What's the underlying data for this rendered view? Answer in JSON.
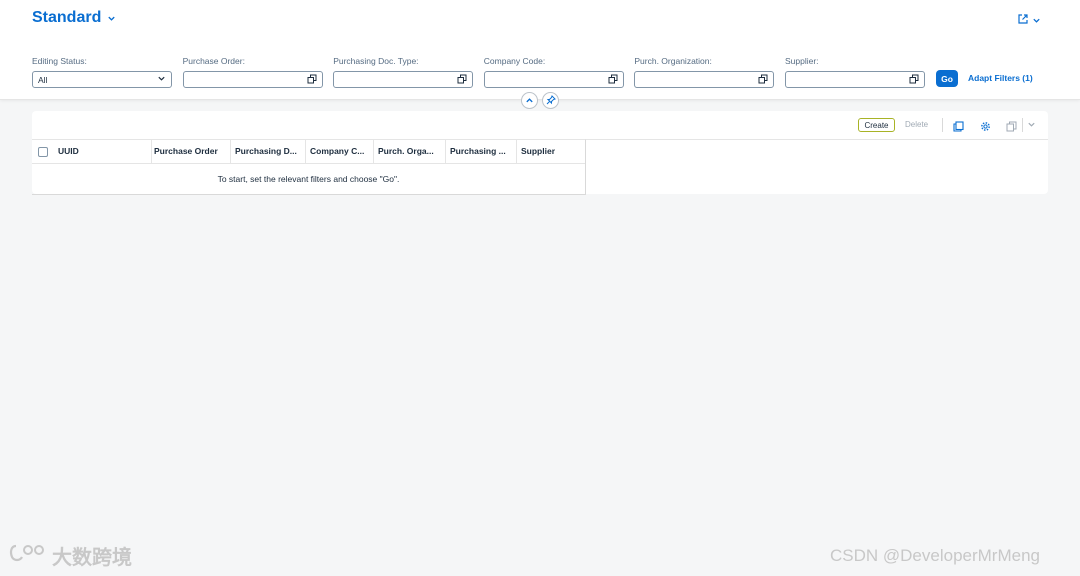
{
  "header": {
    "variant_title": "Standard"
  },
  "filters": [
    {
      "label": "Editing Status:",
      "value": "All",
      "kind": "select"
    },
    {
      "label": "Purchase Order:",
      "value": "",
      "kind": "valuehelp"
    },
    {
      "label": "Purchasing Doc. Type:",
      "value": "",
      "kind": "valuehelp"
    },
    {
      "label": "Company Code:",
      "value": "",
      "kind": "valuehelp"
    },
    {
      "label": "Purch. Organization:",
      "value": "",
      "kind": "valuehelp"
    },
    {
      "label": "Supplier:",
      "value": "",
      "kind": "valuehelp"
    }
  ],
  "filter_bar": {
    "go_label": "Go",
    "adapt_label": "Adapt Filters (1)"
  },
  "toolbar": {
    "create_label": "Create",
    "delete_label": "Delete"
  },
  "table": {
    "columns": [
      "UUID",
      "Purchase Order",
      "Purchasing D...",
      "Company C...",
      "Purch. Orga...",
      "Purchasing ...",
      "Supplier"
    ],
    "empty_message": "To start, set the relevant filters and choose \"Go\"."
  },
  "watermarks": {
    "left": "大数跨境",
    "right": "CSDN @DeveloperMrMeng"
  },
  "colors": {
    "brand": "#0a6ed1",
    "create_border": "#a8b326"
  }
}
